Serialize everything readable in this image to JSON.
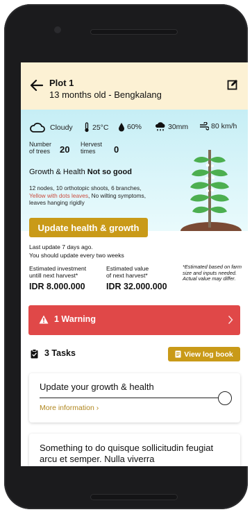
{
  "header": {
    "plot_name": "Plot 1",
    "plot_subtitle": "13 months old - Bengkalang"
  },
  "weather": {
    "condition": "Cloudy",
    "temperature": "25°C",
    "humidity": "60%",
    "rainfall": "30mm",
    "wind": "80 km/h"
  },
  "stats": {
    "trees_label_1": "Number",
    "trees_label_2": "of trees",
    "trees_value": "20",
    "harvest_label_1": "Hervest",
    "harvest_label_2": "times",
    "harvest_value": "0"
  },
  "growth": {
    "label": "Growth & Health",
    "value": "Not so good",
    "desc_1": "12 nodes, 10 orthotopic shoots, 6 branches,",
    "desc_warn": "Yellow with dots leaves",
    "desc_2": ", No wilting symptoms,",
    "desc_3": "leaves hanging rigidly"
  },
  "update": {
    "button_label": "Update health & growth",
    "last_update": "Last update 7 days ago.",
    "frequency": "You should update every two weeks"
  },
  "estimates": {
    "investment_label_1": "Estimated investment",
    "investment_label_2": "untill next harvest*",
    "investment_value": "IDR 8.000.000",
    "value_label_1": "Estimated value",
    "value_label_2": "of next harvest*",
    "value_value": "IDR 32.000.000",
    "note": "*Estimated based on farm size and inputs needed. Actual value may differ."
  },
  "warning": {
    "label": "1 Warning",
    "chevron": "›"
  },
  "tasks": {
    "title": "3 Tasks",
    "logbook_label": "View log book",
    "items": [
      {
        "title": "Update your growth & health",
        "more": "More information  ›"
      },
      {
        "title": "Something to do quisque sollicitudin feugiat arcu et semper. Nulla viverra"
      }
    ]
  },
  "colors": {
    "header_bg": "#fcf1d4",
    "accent": "#c99a18",
    "warning": "#e04848",
    "sky": "#c6eef5"
  }
}
